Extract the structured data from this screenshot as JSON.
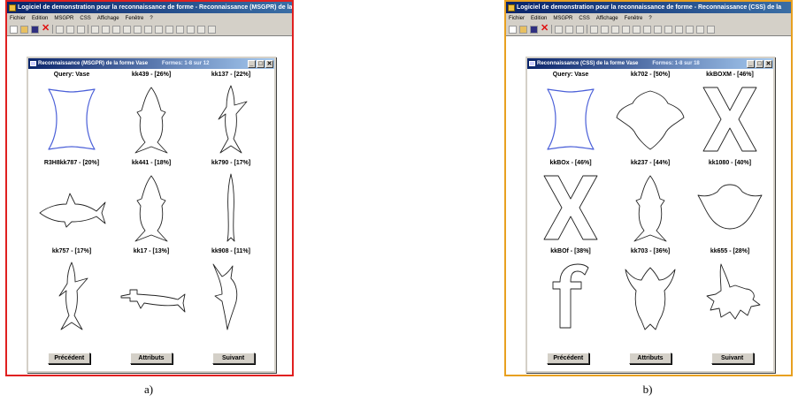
{
  "colors": {
    "outline": "#222222",
    "query_outline": "#4a5fd8",
    "border_a": "#e02020",
    "border_b": "#e8a020"
  },
  "panels": [
    {
      "app_title": "Logiciel de demonstration pour la reconnaissance de forme - Reconnaissance (MSGPR) de la",
      "menu": [
        "Fichier",
        "Edition",
        "MSGPR",
        "CSS",
        "Affichage",
        "Fenêtre",
        "?"
      ],
      "window_title": "Reconnaissance (MSGPR) de la forme Vase",
      "window_count": "Formes: 1-8 sur 12",
      "cells": [
        {
          "label": "Query: Vase",
          "shape": "vase-icon"
        },
        {
          "label": "kk439 - [26%]",
          "shape": "fish-upright-icon"
        },
        {
          "label": "kk137 - [22%]",
          "shape": "shark-upright-icon"
        },
        {
          "label": "R3H8kk787 - [20%]",
          "shape": "shark-horizontal-icon"
        },
        {
          "label": "kk441 - [18%]",
          "shape": "fish-upright-icon"
        },
        {
          "label": "kk790 - [17%]",
          "shape": "eel-upright-icon"
        },
        {
          "label": "kk757 - [17%]",
          "shape": "shark-upright-icon"
        },
        {
          "label": "kk17 - [13%]",
          "shape": "hammerhead-icon"
        },
        {
          "label": "kk908 - [11%]",
          "shape": "swordfish-upright-icon"
        }
      ],
      "buttons": {
        "prev": "Précédent",
        "attr": "Attributs",
        "next": "Suivant"
      },
      "caption": "a)"
    },
    {
      "app_title": "Logiciel de demonstration pour la reconnaissance de forme - Reconnaissance (CSS) de la",
      "menu": [
        "Fichier",
        "Edition",
        "MSGPR",
        "CSS",
        "Affichage",
        "Fenêtre",
        "?"
      ],
      "window_title": "Reconnaissance (CSS) de la forme Vase",
      "window_count": "Formes: 1-8 sur 18",
      "cells": [
        {
          "label": "Query: Vase",
          "shape": "vase-icon"
        },
        {
          "label": "kk702 - [50%]",
          "shape": "ray-icon"
        },
        {
          "label": "kkBOXM - [46%]",
          "shape": "letter-x-icon"
        },
        {
          "label": "kkBOx - [46%]",
          "shape": "letter-x-icon"
        },
        {
          "label": "kk237 - [44%]",
          "shape": "fish-upright-icon"
        },
        {
          "label": "kk1080 - [40%]",
          "shape": "manta-icon"
        },
        {
          "label": "kkBOf - [38%]",
          "shape": "letter-f-icon"
        },
        {
          "label": "kk703 - [36%]",
          "shape": "horned-fish-icon"
        },
        {
          "label": "kk655 - [28%]",
          "shape": "crab-icon"
        }
      ],
      "buttons": {
        "prev": "Précédent",
        "attr": "Attributs",
        "next": "Suivant"
      },
      "caption": "b)"
    }
  ]
}
